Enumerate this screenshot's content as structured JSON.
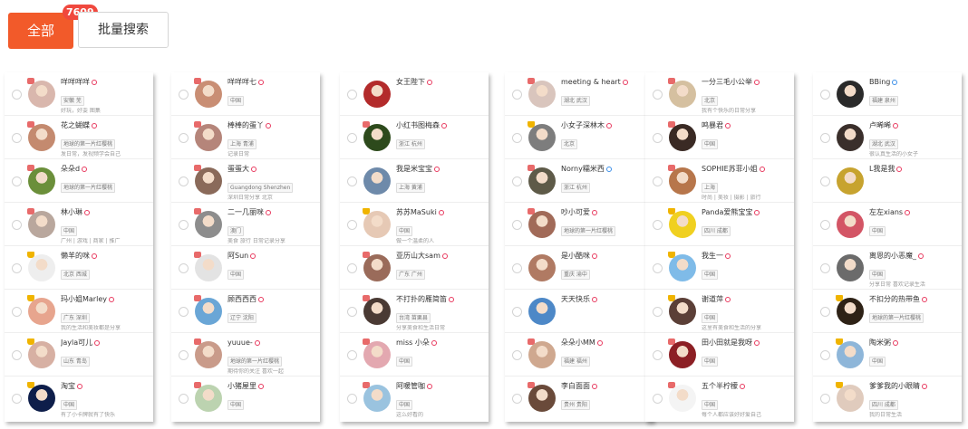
{
  "header": {
    "all_label": "全部",
    "count": "7609",
    "batch_label": "批量搜索"
  },
  "columns": [
    {
      "cards": [
        {
          "name": "咩咩咩咩",
          "gender": "female",
          "tags": [
            "安徽 芜"
          ],
          "bio": "好玩，好耍 图集",
          "avatar": "#d9b7ad",
          "platform": "rec"
        },
        {
          "name": "花之蝴蝶",
          "gender": "female",
          "tags": [
            "地球的第一片红樱桃"
          ],
          "bio": "发日常，发视频学会自己",
          "avatar": "#c48a6f",
          "platform": "rec"
        },
        {
          "name": "朵朵d",
          "gender": "female",
          "tags": [
            "地球的第一片红樱桃"
          ],
          "bio": "",
          "avatar": "#6b8f3a",
          "platform": "rec"
        },
        {
          "name": "林小琳",
          "gender": "female",
          "tags": [
            "中国"
          ],
          "bio": "广州 | 游戏 | 商家 | 推广",
          "avatar": "#b9a79d",
          "platform": "rec"
        },
        {
          "name": "懒羊的咪",
          "gender": "female",
          "tags": [
            "北京 西城"
          ],
          "bio": "",
          "avatar": "#eeeeee",
          "platform": "crown"
        },
        {
          "name": "玛小姐Marley",
          "gender": "female",
          "tags": [
            "广东 深圳"
          ],
          "bio": "我的生活和美妆都是分享",
          "avatar": "#e7a58e",
          "platform": "crown"
        },
        {
          "name": "Jayla可儿",
          "gender": "female",
          "tags": [
            "山东 青岛"
          ],
          "bio": "",
          "avatar": "#d7b0a3",
          "platform": "crown"
        },
        {
          "name": "淘宝",
          "gender": "female",
          "tags": [
            "中国"
          ],
          "bio": "有了小卡牌就有了快乐",
          "avatar": "#0e1e4a",
          "platform": "crown"
        }
      ]
    },
    {
      "cards": [
        {
          "name": "咩咩咩七",
          "gender": "female",
          "tags": [
            "中国"
          ],
          "bio": "",
          "avatar": "#c98e74",
          "platform": "rec"
        },
        {
          "name": "棒棒的蛋丫",
          "gender": "female",
          "tags": [
            "上海 青浦"
          ],
          "bio": "记录日常",
          "avatar": "#b5857a",
          "platform": "rec"
        },
        {
          "name": "蛋蛋大",
          "gender": "female",
          "tags": [
            "Guangdong Shenzhen"
          ],
          "bio": "深圳日常分享 北京",
          "avatar": "#8a6a5a",
          "platform": "rec"
        },
        {
          "name": "二一几丽咪",
          "gender": "female",
          "tags": [
            "澳门"
          ],
          "bio": "美食 旅行 日常记录分享",
          "avatar": "#8d8d8d",
          "platform": "rec"
        },
        {
          "name": "阿Sun",
          "gender": "female",
          "tags": [
            "中国"
          ],
          "bio": "",
          "avatar": "#e3e3e3",
          "platform": "rec"
        },
        {
          "name": "顾西西西",
          "gender": "female",
          "tags": [
            "辽宁 沈阳"
          ],
          "bio": "",
          "avatar": "#6aa6d6",
          "platform": "rec"
        },
        {
          "name": "yuuue-",
          "gender": "female",
          "tags": [
            "地球的第一片红樱桃"
          ],
          "bio": "期待你的关注 喜欢一起",
          "avatar": "#c99b8a",
          "platform": "rec"
        },
        {
          "name": "小猪屋里",
          "gender": "female",
          "tags": [
            "中国"
          ],
          "bio": "",
          "avatar": "#bcd3b0",
          "platform": "rec"
        }
      ]
    },
    {
      "cards": [
        {
          "name": "女王陛下",
          "gender": "female",
          "tags": [],
          "bio": "",
          "avatar": "#b32b2b",
          "platform": "none"
        },
        {
          "name": "小红书图梅森",
          "gender": "female",
          "tags": [
            "浙江 杭州"
          ],
          "bio": "",
          "avatar": "#2d4a1c",
          "platform": "rec"
        },
        {
          "name": "我是米宝宝",
          "gender": "female",
          "tags": [
            "上海 黄浦"
          ],
          "bio": "",
          "avatar": "#6e8aaa",
          "platform": "none"
        },
        {
          "name": "苏苏MaSuki",
          "gender": "female",
          "tags": [
            "中国"
          ],
          "bio": "做一个温柔的人",
          "avatar": "#e6c9b5",
          "platform": "crown"
        },
        {
          "name": "亚历山大sam",
          "gender": "female",
          "tags": [
            "广东 广州"
          ],
          "bio": "",
          "avatar": "#9a6b5a",
          "platform": "rec"
        },
        {
          "name": "不打扑的雁简笛",
          "gender": "female",
          "tags": [
            "台湾 苗栗县"
          ],
          "bio": "分享美食和生活日常",
          "avatar": "#4a3a34",
          "platform": "rec"
        },
        {
          "name": "miss 小朵",
          "gender": "female",
          "tags": [
            "中国"
          ],
          "bio": "",
          "avatar": "#e3a8b0",
          "platform": "rec"
        },
        {
          "name": "阿暖管咖",
          "gender": "female",
          "tags": [
            "中国"
          ],
          "bio": "这么好看的",
          "avatar": "#9ac3df",
          "platform": "rec"
        }
      ]
    },
    {
      "cards": [
        {
          "name": "meeting & heart",
          "gender": "female",
          "tags": [
            "湖北 武汉"
          ],
          "bio": "",
          "avatar": "#d9c5bd",
          "platform": "rec"
        },
        {
          "name": "小女子深林木",
          "gender": "female",
          "tags": [
            "北京"
          ],
          "bio": "",
          "avatar": "#7d7d7d",
          "platform": "crown"
        },
        {
          "name": "Norny糯米西",
          "gender": "male",
          "tags": [
            "浙江 杭州"
          ],
          "bio": "",
          "avatar": "#5e5a48",
          "platform": "rec"
        },
        {
          "name": "吵小可爱",
          "gender": "female",
          "tags": [
            "地球的第一片红樱桃"
          ],
          "bio": "",
          "avatar": "#a16a58",
          "platform": "rec"
        },
        {
          "name": "是小酷咪",
          "gender": "female",
          "tags": [
            "重庆 渝中"
          ],
          "bio": "",
          "avatar": "#b07a63",
          "platform": "none"
        },
        {
          "name": "天天快乐",
          "gender": "female",
          "tags": [],
          "bio": "",
          "avatar": "#4d88c7",
          "platform": "none"
        },
        {
          "name": "朵朵小MM",
          "gender": "female",
          "tags": [
            "福建 福州"
          ],
          "bio": "",
          "avatar": "#cfa88f",
          "platform": "rec"
        },
        {
          "name": "李白面面",
          "gender": "female",
          "tags": [
            "贵州 贵阳"
          ],
          "bio": "",
          "avatar": "#6a4a3a",
          "platform": "rec"
        }
      ]
    },
    {
      "cards": [
        {
          "name": "一分三毛小公举",
          "gender": "female",
          "tags": [
            "北京"
          ],
          "bio": "我有个快乐的日常分享",
          "avatar": "#d5c0a0",
          "platform": "rec"
        },
        {
          "name": "鸣暴君",
          "gender": "female",
          "tags": [
            "中国"
          ],
          "bio": "",
          "avatar": "#3a2a24",
          "platform": "rec"
        },
        {
          "name": "SOPHIE苏菲小姐",
          "gender": "female",
          "tags": [
            "上海"
          ],
          "bio": "时尚 | 美妆 | 摄影 | 旅行",
          "avatar": "#b7764b",
          "platform": "rec"
        },
        {
          "name": "Panda爱熊宝宝",
          "gender": "female",
          "tags": [
            "四川 成都"
          ],
          "bio": "",
          "avatar": "#f0d020",
          "platform": "crown"
        },
        {
          "name": "我生一",
          "gender": "female",
          "tags": [
            "中国"
          ],
          "bio": "",
          "avatar": "#7fbbe8",
          "platform": "crown"
        },
        {
          "name": "谢道萍",
          "gender": "female",
          "tags": [
            "中国"
          ],
          "bio": "这里有美食和生活的分享",
          "avatar": "#5b3f37",
          "platform": "crown"
        },
        {
          "name": "田小田就是我呀",
          "gender": "female",
          "tags": [
            "中国"
          ],
          "bio": "",
          "avatar": "#8c1f24",
          "platform": "rec"
        },
        {
          "name": "五个半柠檬",
          "gender": "female",
          "tags": [
            "中国"
          ],
          "bio": "每个人都应该好好爱自己",
          "avatar": "#f4f4f4",
          "platform": "rec"
        }
      ]
    },
    {
      "cards": [
        {
          "name": "BBing",
          "gender": "male",
          "tags": [
            "福建 泉州"
          ],
          "bio": "",
          "avatar": "#2a2a2a",
          "platform": "none"
        },
        {
          "name": "卢晞晞",
          "gender": "female",
          "tags": [
            "湖北 武汉"
          ],
          "bio": "很认真生活的小女子",
          "avatar": "#3a2f2b",
          "platform": "none"
        },
        {
          "name": "L我是我",
          "gender": "female",
          "tags": [],
          "bio": "",
          "avatar": "#c7a32f",
          "platform": "none"
        },
        {
          "name": "左左xians",
          "gender": "female",
          "tags": [
            "中国"
          ],
          "bio": "",
          "avatar": "#d35565",
          "platform": "none"
        },
        {
          "name": "离恩的小恶魔_",
          "gender": "female",
          "tags": [
            "中国"
          ],
          "bio": "分享日常 喜欢记录生活",
          "avatar": "#6b6b6b",
          "platform": "none"
        },
        {
          "name": "不扣分的热带鱼",
          "gender": "female",
          "tags": [
            "地球的第一片红樱桃"
          ],
          "bio": "",
          "avatar": "#2e2216",
          "platform": "crown"
        },
        {
          "name": "陶米粥",
          "gender": "female",
          "tags": [
            "中国"
          ],
          "bio": "",
          "avatar": "#8eb6d9",
          "platform": "crown"
        },
        {
          "name": "爹爹我的小眼睛",
          "gender": "female",
          "tags": [
            "四川 成都"
          ],
          "bio": "我的日常生活",
          "avatar": "#e0cbbd",
          "platform": "crown"
        }
      ]
    }
  ]
}
